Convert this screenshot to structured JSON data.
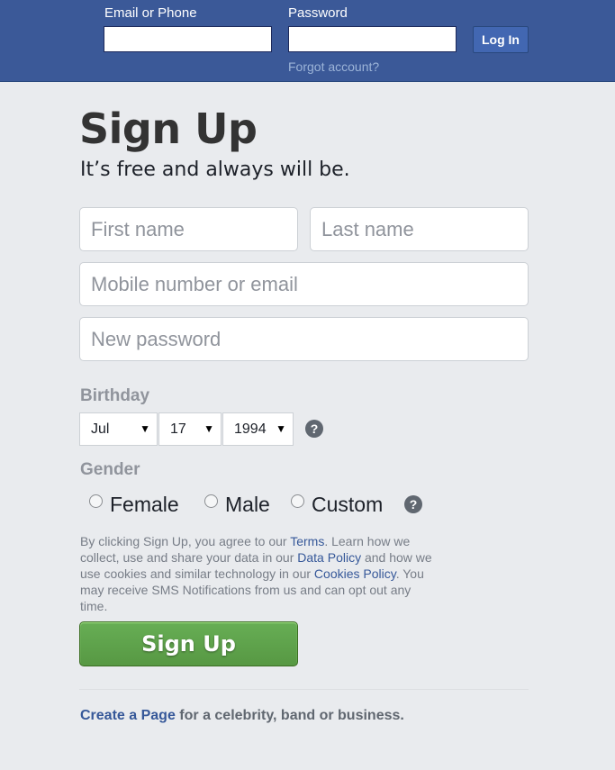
{
  "header": {
    "email_label": "Email or Phone",
    "password_label": "Password",
    "login_button": "Log In",
    "forgot_link": "Forgot account?"
  },
  "signup": {
    "title": "Sign Up",
    "subtitle": "It’s free and always will be.",
    "first_name_placeholder": "First name",
    "last_name_placeholder": "Last name",
    "mobile_placeholder": "Mobile number or email",
    "password_placeholder": "New password",
    "birthday_label": "Birthday",
    "birthday": {
      "month": "Jul",
      "day": "17",
      "year": "1994"
    },
    "help_glyph": "?",
    "gender_label": "Gender",
    "gender_options": [
      "Female",
      "Male",
      "Custom"
    ],
    "terms": {
      "part1": "By clicking Sign Up, you agree to our ",
      "terms_link": "Terms",
      "part2": ". Learn how we collect, use and share your data in our ",
      "data_policy_link": "Data Policy",
      "part3": " and how we use cookies and similar technology in our ",
      "cookies_link": "Cookies Policy",
      "part4": ". You may receive SMS Notifications from us and can opt out any time."
    },
    "submit_button": "Sign Up"
  },
  "footer": {
    "create_page_link": "Create a Page",
    "create_page_text": " for a celebrity, band or business."
  },
  "colors": {
    "header_bg": "#3b5998",
    "button_green": "#579843",
    "link_blue": "#365899"
  }
}
